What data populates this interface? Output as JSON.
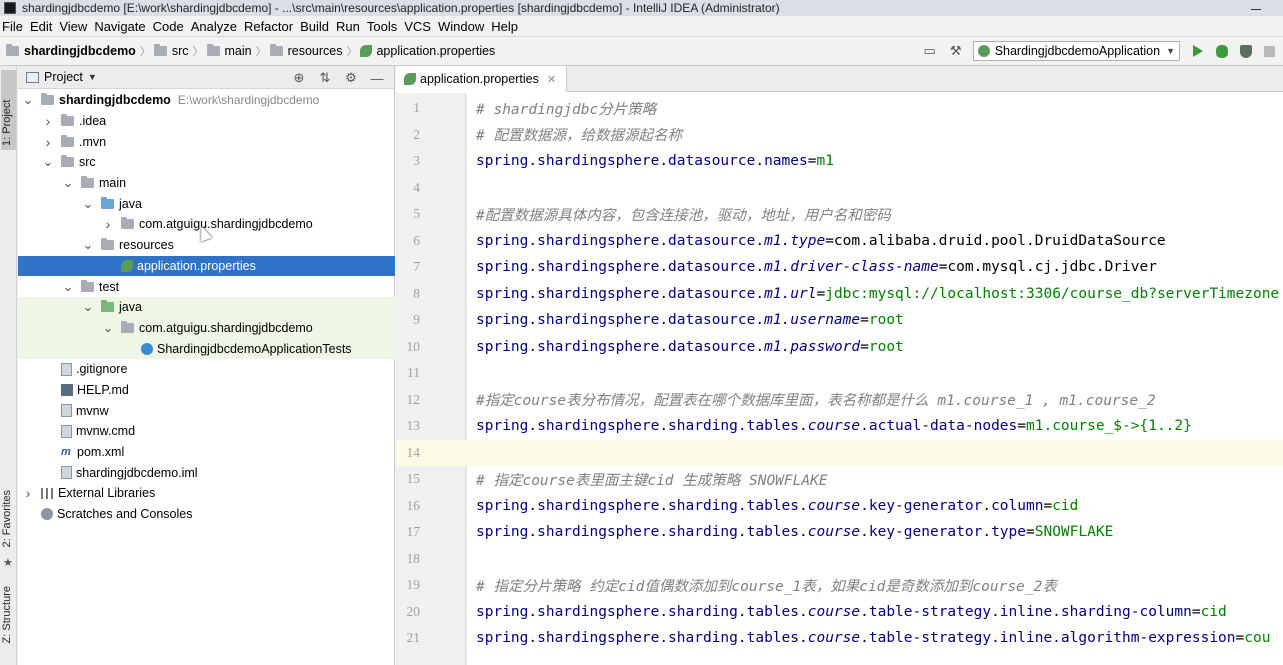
{
  "window": {
    "title": "shardingjdbcdemo [E:\\work\\shardingjdbcdemo] - ...\\src\\main\\resources\\application.properties [shardingjdbcdemo] - IntelliJ IDEA (Administrator)"
  },
  "menu": [
    "File",
    "Edit",
    "View",
    "Navigate",
    "Code",
    "Analyze",
    "Refactor",
    "Build",
    "Run",
    "Tools",
    "VCS",
    "Window",
    "Help"
  ],
  "breadcrumb": {
    "project": "shardingjdbcdemo",
    "items": [
      "src",
      "main",
      "resources",
      "application.properties"
    ]
  },
  "run_config": {
    "label": "ShardingjdbcdemoApplication"
  },
  "side_tabs": {
    "project": "1: Project",
    "favorites": "2: Favorites",
    "structure": "Z: Structure"
  },
  "project_panel": {
    "title": "Project",
    "tree": [
      {
        "label": "shardingjdbcdemo",
        "hint": "E:\\work\\shardingjdbcdemo",
        "depth": 0,
        "arrow": "down",
        "icon": "folder-icon",
        "bold": true
      },
      {
        "label": ".idea",
        "depth": 1,
        "arrow": "right",
        "icon": "folder-icon"
      },
      {
        "label": ".mvn",
        "depth": 1,
        "arrow": "right",
        "icon": "folder-icon"
      },
      {
        "label": "src",
        "depth": 1,
        "arrow": "down",
        "icon": "folder-icon"
      },
      {
        "label": "main",
        "depth": 2,
        "arrow": "down",
        "icon": "folder-icon"
      },
      {
        "label": "java",
        "depth": 3,
        "arrow": "down",
        "icon": "source-folder-icon"
      },
      {
        "label": "com.atguigu.shardingjdbcdemo",
        "depth": 4,
        "arrow": "right",
        "icon": "package-icon"
      },
      {
        "label": "resources",
        "depth": 3,
        "arrow": "down",
        "icon": "resources-folder-icon"
      },
      {
        "label": "application.properties",
        "depth": 4,
        "arrow": "",
        "icon": "properties-file-icon",
        "selected": true
      },
      {
        "label": "test",
        "depth": 2,
        "arrow": "down",
        "icon": "folder-icon"
      },
      {
        "label": "java",
        "depth": 3,
        "arrow": "down",
        "icon": "test-folder-icon",
        "test": true
      },
      {
        "label": "com.atguigu.shardingjdbcdemo",
        "depth": 4,
        "arrow": "down",
        "icon": "package-icon",
        "test": true
      },
      {
        "label": "ShardingjdbcdemoApplicationTests",
        "depth": 5,
        "arrow": "",
        "icon": "class-icon",
        "test": true
      },
      {
        "label": ".gitignore",
        "depth": 1,
        "arrow": "",
        "icon": "file-icon"
      },
      {
        "label": "HELP.md",
        "depth": 1,
        "arrow": "",
        "icon": "markdown-icon"
      },
      {
        "label": "mvnw",
        "depth": 1,
        "arrow": "",
        "icon": "file-icon"
      },
      {
        "label": "mvnw.cmd",
        "depth": 1,
        "arrow": "",
        "icon": "file-icon"
      },
      {
        "label": "pom.xml",
        "depth": 1,
        "arrow": "",
        "icon": "maven-icon"
      },
      {
        "label": "shardingjdbcdemo.iml",
        "depth": 1,
        "arrow": "",
        "icon": "file-icon"
      },
      {
        "label": "External Libraries",
        "depth": 0,
        "arrow": "right",
        "icon": "library-icon"
      },
      {
        "label": "Scratches and Consoles",
        "depth": 0,
        "arrow": "",
        "icon": "scratches-icon"
      }
    ]
  },
  "editor": {
    "tab": "application.properties",
    "current_line": 14,
    "lines": [
      {
        "n": "1",
        "t": [
          [
            "c",
            "# shardingjdbc分片策略"
          ]
        ]
      },
      {
        "n": "2",
        "t": [
          [
            "c",
            "# 配置数据源，给数据源起名称"
          ]
        ]
      },
      {
        "n": "3",
        "t": [
          [
            "k",
            "spring.shardingsphere.datasource.names"
          ],
          [
            "e",
            "="
          ],
          [
            "v",
            "m1"
          ]
        ]
      },
      {
        "n": "4",
        "t": []
      },
      {
        "n": "5",
        "t": [
          [
            "c",
            "#配置数据源具体内容，包含连接池，驱动，地址，用户名和密码"
          ]
        ]
      },
      {
        "n": "6",
        "t": [
          [
            "k",
            "spring.shardingsphere.datasource."
          ],
          [
            "i",
            "m1.type"
          ],
          [
            "e",
            "=com.alibaba.druid.pool.DruidDataSource"
          ]
        ]
      },
      {
        "n": "7",
        "t": [
          [
            "k",
            "spring.shardingsphere.datasource."
          ],
          [
            "i",
            "m1.driver-class-name"
          ],
          [
            "e",
            "=com.mysql.cj.jdbc.Driver"
          ]
        ]
      },
      {
        "n": "8",
        "t": [
          [
            "k",
            "spring.shardingsphere.datasource."
          ],
          [
            "i",
            "m1.url"
          ],
          [
            "e",
            "="
          ],
          [
            "v",
            "jdbc:mysql://localhost:3306/course_db?serverTimezone"
          ]
        ]
      },
      {
        "n": "9",
        "t": [
          [
            "k",
            "spring.shardingsphere.datasource."
          ],
          [
            "i",
            "m1.username"
          ],
          [
            "e",
            "="
          ],
          [
            "v",
            "root"
          ]
        ]
      },
      {
        "n": "10",
        "t": [
          [
            "k",
            "spring.shardingsphere.datasource."
          ],
          [
            "i",
            "m1.password"
          ],
          [
            "e",
            "="
          ],
          [
            "v",
            "root"
          ]
        ]
      },
      {
        "n": "11",
        "t": []
      },
      {
        "n": "12",
        "t": [
          [
            "c",
            "#指定course表分布情况，配置表在哪个数据库里面，表名称都是什么  m1.course_1 , m1.course_2"
          ]
        ]
      },
      {
        "n": "13",
        "t": [
          [
            "k",
            "spring.shardingsphere.sharding.tables."
          ],
          [
            "i",
            "course"
          ],
          [
            "k",
            ".actual-data-nodes"
          ],
          [
            "e",
            "="
          ],
          [
            "v",
            "m1.course_$->{1..2}"
          ]
        ]
      },
      {
        "n": "14",
        "t": []
      },
      {
        "n": "15",
        "t": [
          [
            "c",
            "# 指定course表里面主键cid 生成策略  SNOWFLAKE"
          ]
        ]
      },
      {
        "n": "16",
        "t": [
          [
            "k",
            "spring.shardingsphere.sharding.tables."
          ],
          [
            "i",
            "course"
          ],
          [
            "k",
            ".key-generator.column"
          ],
          [
            "e",
            "="
          ],
          [
            "v",
            "cid"
          ]
        ]
      },
      {
        "n": "17",
        "t": [
          [
            "k",
            "spring.shardingsphere.sharding.tables."
          ],
          [
            "i",
            "course"
          ],
          [
            "k",
            ".key-generator.type"
          ],
          [
            "e",
            "="
          ],
          [
            "v",
            "SNOWFLAKE"
          ]
        ]
      },
      {
        "n": "18",
        "t": []
      },
      {
        "n": "19",
        "t": [
          [
            "c",
            "# 指定分片策略  约定cid值偶数添加到course_1表，如果cid是奇数添加到course_2表"
          ]
        ]
      },
      {
        "n": "20",
        "t": [
          [
            "k",
            "spring.shardingsphere.sharding.tables."
          ],
          [
            "i",
            "course"
          ],
          [
            "k",
            ".table-strategy.inline.sharding-column"
          ],
          [
            "e",
            "="
          ],
          [
            "v",
            "cid"
          ]
        ]
      },
      {
        "n": "21",
        "t": [
          [
            "k",
            "spring.shardingsphere.sharding.tables."
          ],
          [
            "i",
            "course"
          ],
          [
            "k",
            ".table-strategy.inline.algorithm-expression"
          ],
          [
            "e",
            "="
          ],
          [
            "v",
            "cou"
          ]
        ]
      }
    ]
  }
}
